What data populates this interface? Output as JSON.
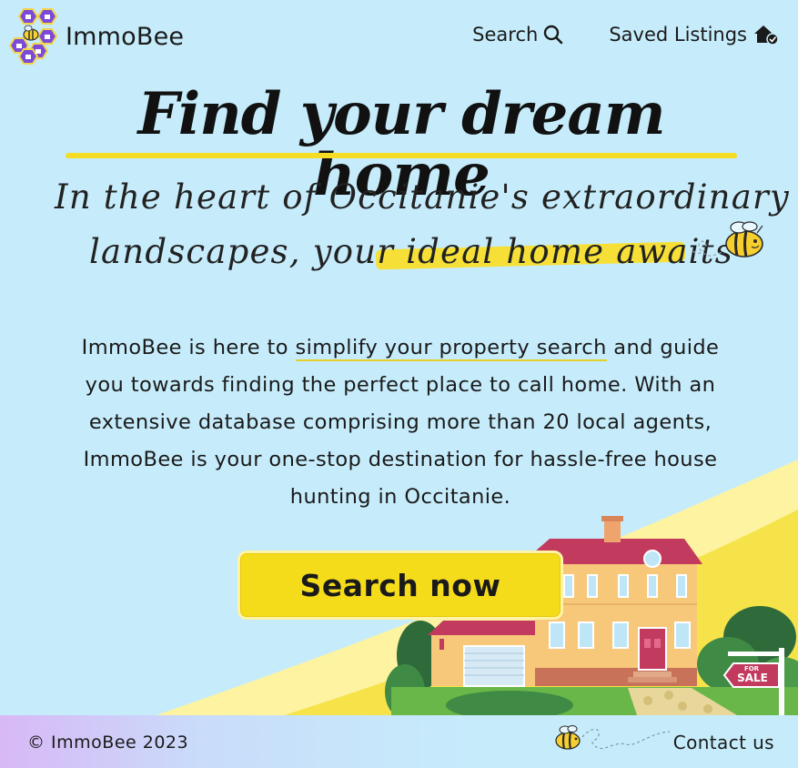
{
  "header": {
    "logo_text": "ImmoBee",
    "nav": [
      {
        "label": "Search",
        "icon": "search-icon"
      },
      {
        "label": "Saved Listings",
        "icon": "saved-home-icon"
      }
    ]
  },
  "hero": {
    "title": "Find your dream home",
    "subtitle_line1": "In the heart of Occitanie's extraordinary",
    "subtitle_line2_a": "landscapes, your ",
    "subtitle_line2_b": "ideal home awaits"
  },
  "intro": {
    "part1": "ImmoBee is here to ",
    "link": "simplify your property search",
    "part2": " and guide you towards finding the perfect place to call home. With an extensive database comprising more than 20 local agents, ImmoBee is your one-stop destination for hassle-free house hunting in Occitanie."
  },
  "cta": {
    "label": "Search now"
  },
  "sign": {
    "top": "FOR",
    "main": "SALE"
  },
  "footer": {
    "copyright": "© ImmoBee 2023",
    "contact": "Contact us"
  },
  "colors": {
    "background": "#c6ecfb",
    "accent_yellow": "#f5dc1b",
    "logo_purple": "#6a3fd0",
    "roof": "#c23a5e",
    "house": "#f7c77a"
  }
}
